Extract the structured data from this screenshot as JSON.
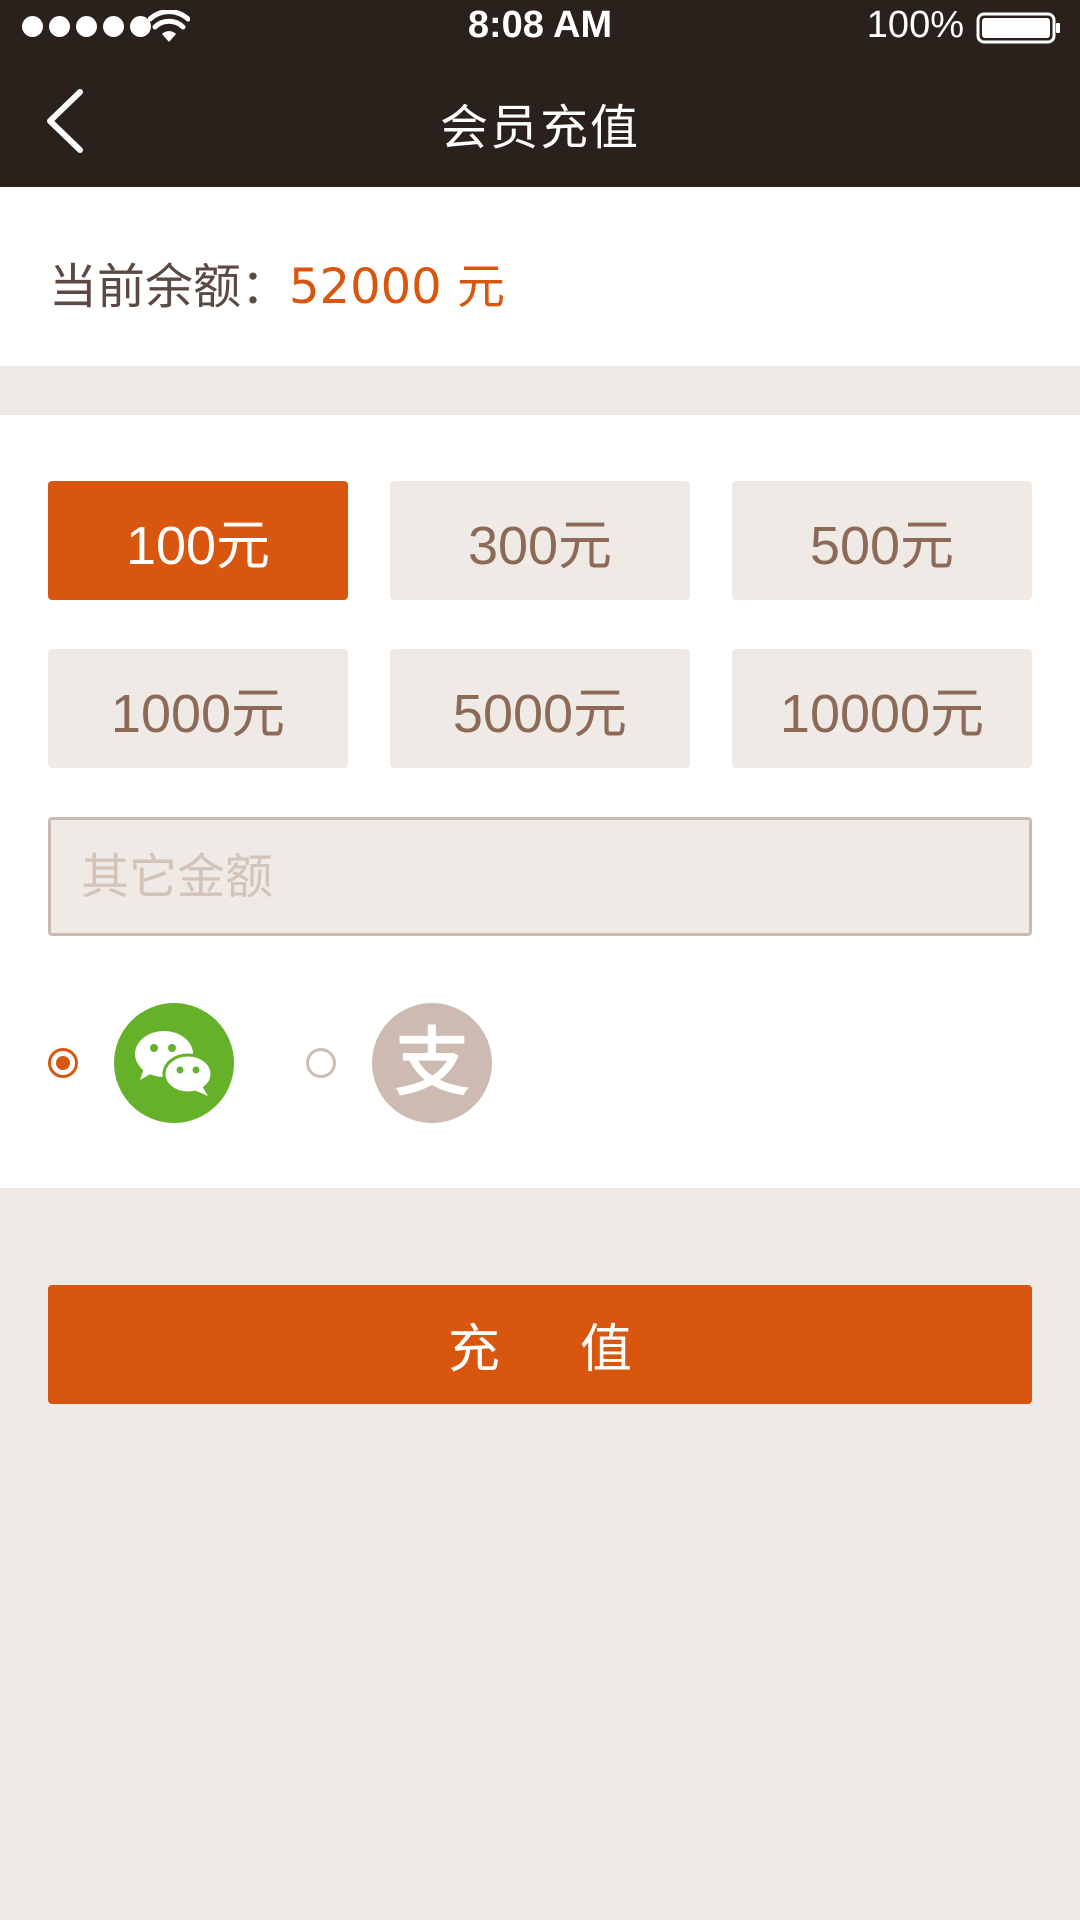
{
  "status_bar": {
    "time": "8:08 AM",
    "battery": "100%"
  },
  "nav": {
    "title": "会员充值",
    "back_icon": "chevron-left-icon"
  },
  "balance": {
    "label": "当前余额：",
    "value": "52000 元"
  },
  "amounts": [
    "100元",
    "300元",
    "500元",
    "1000元",
    "5000元",
    "10000元"
  ],
  "selected_amount": "100元",
  "other_amount": {
    "placeholder": "其它金额",
    "value": ""
  },
  "payment_methods": [
    {
      "icon": "wechat-icon",
      "selected": true
    },
    {
      "icon": "alipay-icon",
      "glyph": "支",
      "selected": false
    }
  ],
  "submit_label": "充值",
  "colors": {
    "accent": "#d9560f",
    "header_bg": "#2a201c",
    "page_bg": "#efeae6",
    "wechat_green": "#65b22a",
    "alipay_gray": "#cdbab0"
  }
}
